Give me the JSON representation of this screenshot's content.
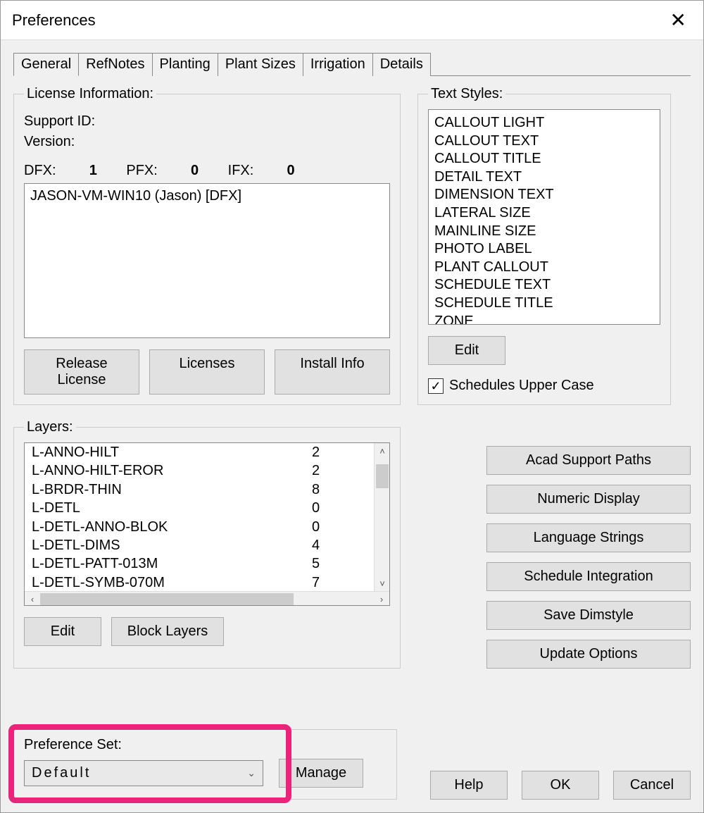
{
  "window": {
    "title": "Preferences"
  },
  "tabs": {
    "general": "General",
    "refnotes": "RefNotes",
    "planting": "Planting",
    "plantsizes": "Plant Sizes",
    "irrigation": "Irrigation",
    "details": "Details"
  },
  "license": {
    "legend": "License Information:",
    "supportid_label": "Support ID:",
    "version_label": "Version:",
    "dfx_label": "DFX:",
    "dfx_val": "1",
    "pfx_label": "PFX:",
    "pfx_val": "0",
    "ifx_label": "IFX:",
    "ifx_val": "0",
    "entry": "JASON-VM-WIN10 (Jason) [DFX]",
    "release_btn": "Release License",
    "licenses_btn": "Licenses",
    "install_btn": "Install Info"
  },
  "textstyles": {
    "legend": "Text Styles:",
    "items": [
      "CALLOUT LIGHT",
      "CALLOUT TEXT",
      "CALLOUT TITLE",
      "DETAIL TEXT",
      "DIMENSION TEXT",
      "LATERAL SIZE",
      "MAINLINE SIZE",
      "PHOTO LABEL",
      "PLANT CALLOUT",
      "SCHEDULE TEXT",
      "SCHEDULE TITLE",
      "ZONE"
    ],
    "edit_btn": "Edit",
    "schedules_upper_label": "Schedules Upper Case"
  },
  "layers": {
    "legend": "Layers:",
    "rows": [
      {
        "name": "L-ANNO-HILT",
        "val": "2"
      },
      {
        "name": "L-ANNO-HILT-EROR",
        "val": "2"
      },
      {
        "name": "L-BRDR-THIN",
        "val": "8"
      },
      {
        "name": "L-DETL",
        "val": "0"
      },
      {
        "name": "L-DETL-ANNO-BLOK",
        "val": "0"
      },
      {
        "name": "L-DETL-DIMS",
        "val": "4"
      },
      {
        "name": "L-DETL-PATT-013M",
        "val": "5"
      },
      {
        "name": "L-DETL-SYMB-070M",
        "val": "7"
      }
    ],
    "edit_btn": "Edit",
    "block_layers_btn": "Block Layers"
  },
  "rightbuttons": {
    "acad": "Acad Support Paths",
    "numeric": "Numeric Display",
    "lang": "Language Strings",
    "sched": "Schedule Integration",
    "save": "Save Dimstyle",
    "update": "Update Options"
  },
  "prefset": {
    "label": "Preference Set:",
    "value": "Default",
    "manage_btn": "Manage"
  },
  "bottom": {
    "help": "Help",
    "ok": "OK",
    "cancel": "Cancel"
  }
}
